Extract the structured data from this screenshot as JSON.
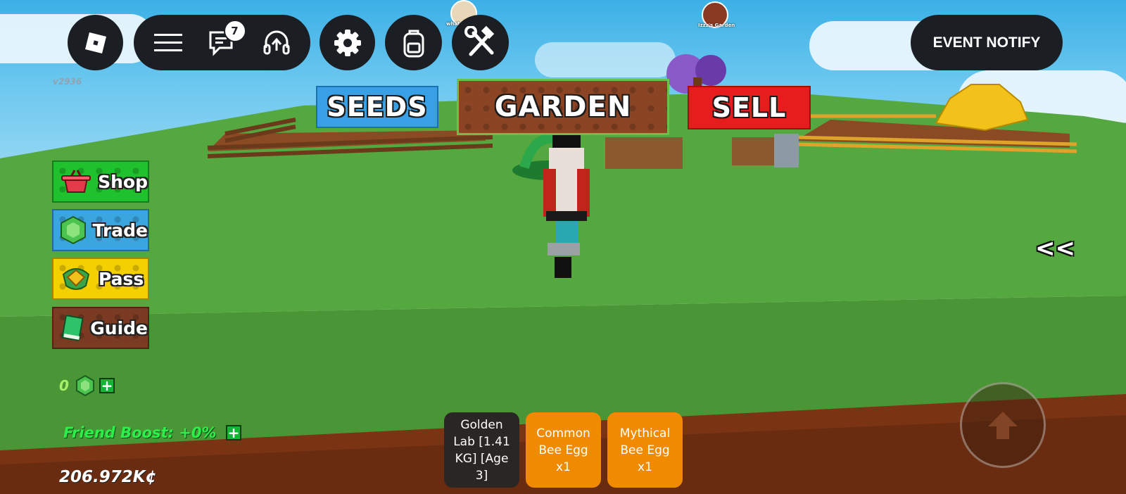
{
  "top_bar": {
    "chat_badge_count": "7",
    "event_notify_label": "EVENT NOTIFY",
    "version_label": "v2936"
  },
  "nameplates": {
    "player_tag_1": "what",
    "player_tag_2": "Izzz's Garden"
  },
  "world_signs": {
    "seeds_label": "SEEDS",
    "garden_label": "GARDEN",
    "sell_label": "SELL"
  },
  "side_menu": {
    "items": [
      {
        "label": "Shop",
        "color": "#1fc12d"
      },
      {
        "label": "Trade",
        "color": "#39a6df"
      },
      {
        "label": "Pass",
        "color": "#f5d000"
      },
      {
        "label": "Guide",
        "color": "#7a3b22"
      }
    ]
  },
  "stats": {
    "coins_value": "0",
    "friend_boost": "Friend Boost: +0%",
    "currency": "206.972K¢"
  },
  "hotbar": {
    "slots": [
      {
        "label": "Golden Lab [1.41 KG] [Age 3]",
        "color": "#2a2623"
      },
      {
        "label": "Common Bee Egg x1",
        "color": "#f08a00"
      },
      {
        "label": "Mythical Bee Egg x1",
        "color": "#f08a00"
      }
    ]
  },
  "collapse_label": "<<",
  "colors": {
    "topbar_bg": "#1b1f24",
    "grass": "#4e9c3a",
    "sky": "#55bfec"
  }
}
